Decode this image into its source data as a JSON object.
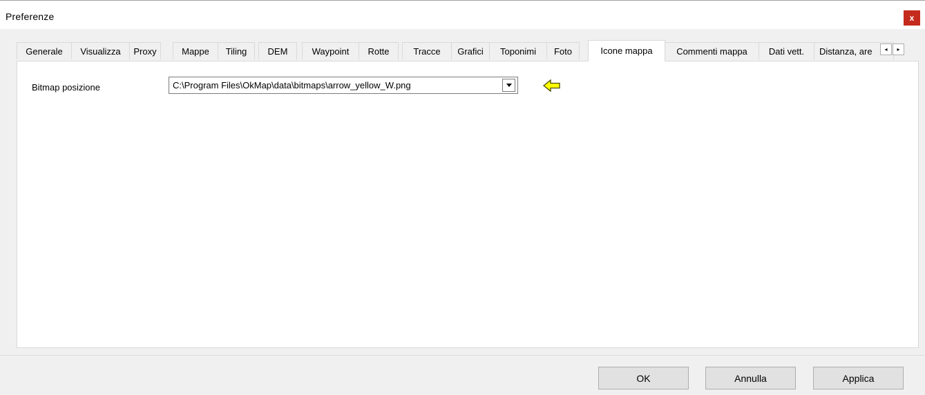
{
  "window": {
    "title": "Preferenze",
    "close_glyph": "x"
  },
  "tabs": [
    {
      "label": "Generale",
      "active": false
    },
    {
      "label": "Visualizza",
      "active": false
    },
    {
      "label": "Proxy",
      "active": false
    },
    {
      "label": "Mappe",
      "active": false
    },
    {
      "label": "Tiling",
      "active": false
    },
    {
      "label": "DEM",
      "active": false
    },
    {
      "label": "Waypoint",
      "active": false
    },
    {
      "label": "Rotte",
      "active": false
    },
    {
      "label": "Tracce",
      "active": false
    },
    {
      "label": "Grafici",
      "active": false
    },
    {
      "label": "Toponimi",
      "active": false
    },
    {
      "label": "Foto",
      "active": false
    },
    {
      "label": "Icone mappa",
      "active": true
    },
    {
      "label": "Commenti mappa",
      "active": false
    },
    {
      "label": "Dati vett.",
      "active": false
    },
    {
      "label": "Distanza, are",
      "active": false
    }
  ],
  "tab_scroll": {
    "left": "◂",
    "right": "▸"
  },
  "form": {
    "bitmap_label": "Bitmap posizione",
    "bitmap_value": "C:\\Program Files\\OkMap\\data\\bitmaps\\arrow_yellow_W.png",
    "preview_icon": "arrow-left-yellow-icon",
    "preview_color": "#ffff00"
  },
  "buttons": {
    "ok": "OK",
    "cancel": "Annulla",
    "apply": "Applica"
  },
  "colors": {
    "close_bg": "#c42b1c",
    "tab_active_bg": "#ffffff",
    "dialog_bg": "#f0f0f0"
  }
}
